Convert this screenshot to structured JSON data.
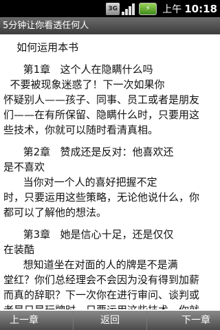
{
  "status_bar": {
    "network_icon": "3G",
    "battery_icon": "battery-charging-icon",
    "label": "上午",
    "time": "10:18"
  },
  "title": "5分钟让你看透任何人",
  "content": {
    "lines": [
      "    如何运用本书",
      "",
      "      第1章   这个人在隐瞒什么吗",
      "  不要被现象迷惑了！下一次如果你",
      "怀疑别人——孩子、同事、员工或者是朋友",
      "们——在有所保留、隐瞒什么时，只要用这",
      "些技术，你就可以随时看清真相。",
      "",
      "      第2章   赞成还是反对：他喜欢还",
      "是不喜欢",
      "      当你对一个人的喜好把握不定",
      "时，只要运用这些策略，无论他说什么，你",
      "都可以了解他的想法。",
      "",
      "      第3章   她是信心十足，还是仅仅",
      "在装酷",
      "      想知道坐在对面的人的牌是不是满",
      "堂红？你们总经理会不会因为没有得到加薪",
      "而真的辞职？下一次你在进行审问、谈判或",
      "者是只是玩牌时，只要运用这些技术，你就"
    ]
  },
  "bottom_bar": {
    "prev_label": "上一章",
    "back_label": "返回",
    "next_label": "下一章"
  }
}
